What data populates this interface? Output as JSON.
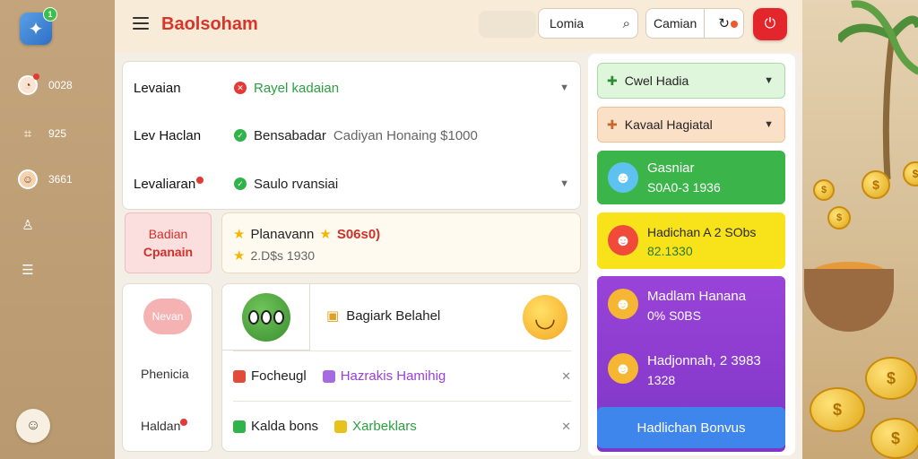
{
  "rail": {
    "logo_badge": "1",
    "items": [
      {
        "icon": "user-badge-icon",
        "label": "0028"
      },
      {
        "icon": "grid-icon",
        "label": "925"
      },
      {
        "icon": "person-avatar-icon",
        "label": "3661"
      },
      {
        "icon": "person-icon",
        "label": ""
      },
      {
        "icon": "list-icon",
        "label": ""
      }
    ]
  },
  "topbar": {
    "brand": "Baolsoham",
    "search_label": "Lomia",
    "campaign_label": "Camian"
  },
  "filters": [
    {
      "name": "Levaian",
      "value": "Rayel kadaian",
      "status": "red",
      "chevron": true
    },
    {
      "name": "Lev Haclan",
      "value": "Bensabadar",
      "extra": "Cadiyan Honaing $1000",
      "status": "green",
      "chevron": false
    },
    {
      "name": "Levaliaran",
      "value": "Saulo rvansiai",
      "status": "green",
      "chevron": true,
      "dot": true
    }
  ],
  "promo_button": {
    "line1": "Badian",
    "line2": "Cpanain"
  },
  "featured": {
    "title": "Planavann",
    "highlight": "S06s0)",
    "sub": "2.D$s 1930"
  },
  "subnav": {
    "pill": "Nevan",
    "items": [
      "Phenicia",
      "Haldan"
    ]
  },
  "list": {
    "top_item": "Bagiark Belahel",
    "rows": [
      {
        "a": "Focheugl",
        "b": "Hazrakis Hamihig"
      },
      {
        "a": "Kalda bons",
        "b": "Xarbeklars"
      }
    ]
  },
  "right": {
    "drop1": "Cwel Hadia",
    "drop2": "Kavaal Hagiatal",
    "tiles": [
      {
        "t1": "Gasniar",
        "t2": "S0A0-3 1936",
        "color": "#3bb54a"
      },
      {
        "t1": "Hadichan A 2 SObs",
        "t2": "82.1330",
        "color": "#f8e21a"
      },
      {
        "t1": "Madlam Hanana",
        "t2": "0% S0BS",
        "color": "#9a43d9"
      },
      {
        "t1": "Hadjonnah, 2 3983",
        "t2": "1328",
        "color": "#9a43d9"
      }
    ],
    "bonus_button": "Hadlichan Bonvus"
  }
}
